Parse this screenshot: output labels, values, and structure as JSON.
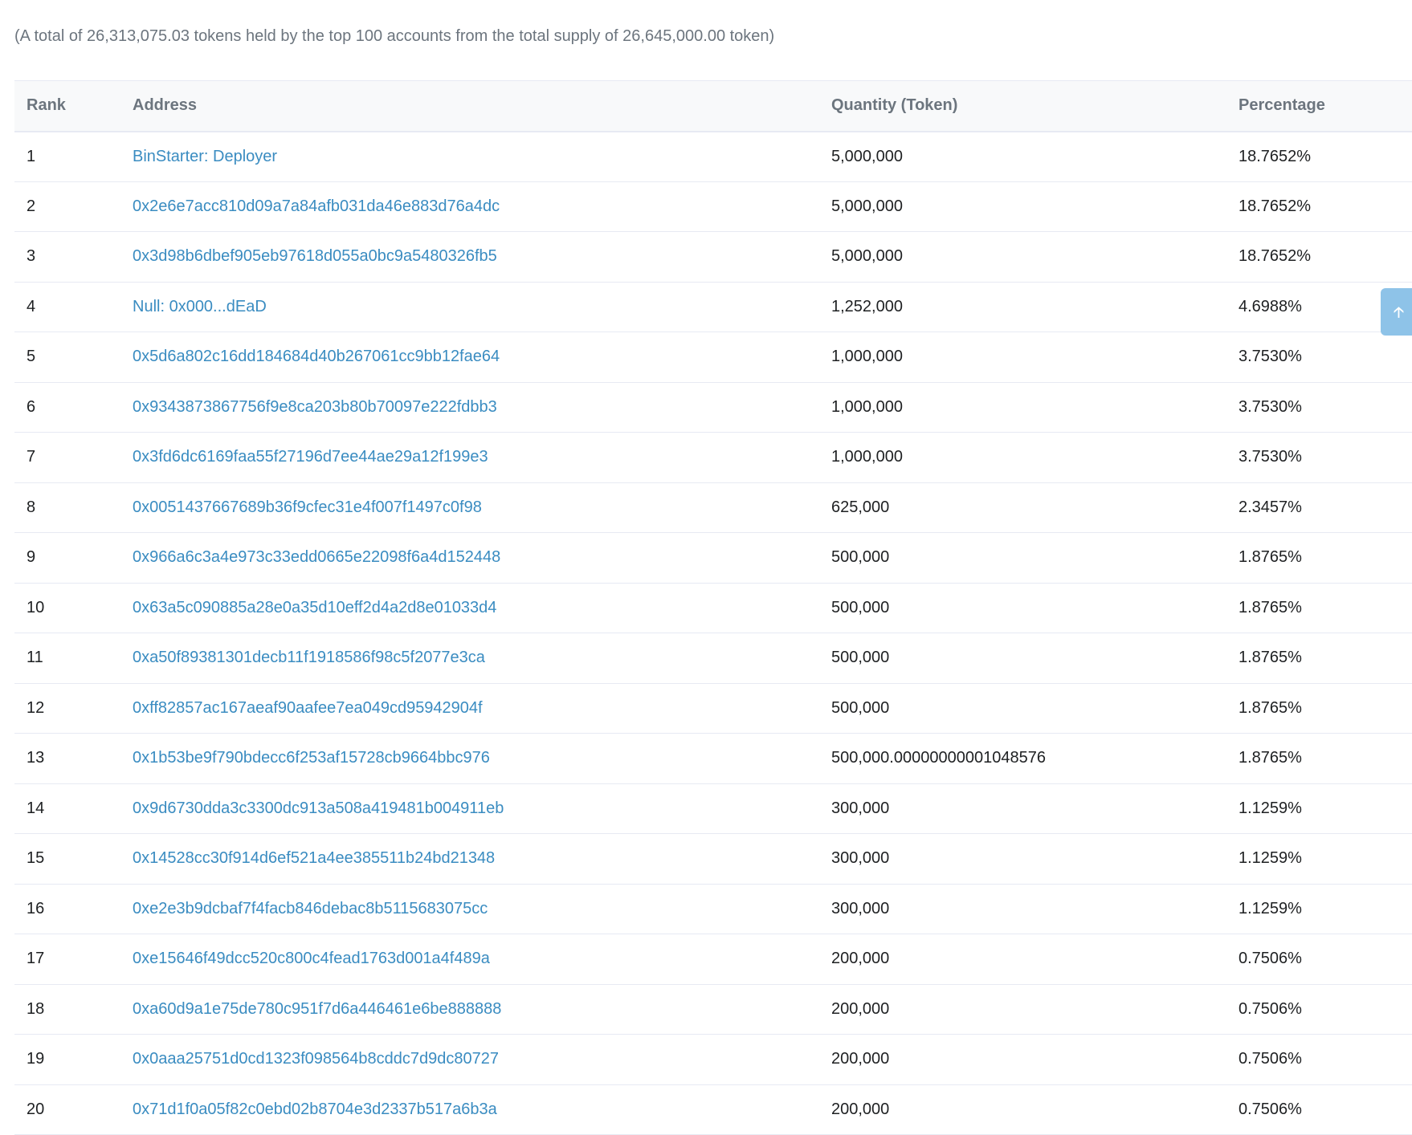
{
  "summary": "(A total of 26,313,075.03 tokens held by the top 100 accounts from the total supply of 26,645,000.00 token)",
  "table": {
    "headers": {
      "rank": "Rank",
      "address": "Address",
      "quantity": "Quantity (Token)",
      "percentage": "Percentage"
    },
    "rows": [
      {
        "rank": "1",
        "address": "BinStarter: Deployer",
        "quantity": "5,000,000",
        "percentage": "18.7652%"
      },
      {
        "rank": "2",
        "address": "0x2e6e7acc810d09a7a84afb031da46e883d76a4dc",
        "quantity": "5,000,000",
        "percentage": "18.7652%"
      },
      {
        "rank": "3",
        "address": "0x3d98b6dbef905eb97618d055a0bc9a5480326fb5",
        "quantity": "5,000,000",
        "percentage": "18.7652%"
      },
      {
        "rank": "4",
        "address": "Null: 0x000...dEaD",
        "quantity": "1,252,000",
        "percentage": "4.6988%"
      },
      {
        "rank": "5",
        "address": "0x5d6a802c16dd184684d40b267061cc9bb12fae64",
        "quantity": "1,000,000",
        "percentage": "3.7530%"
      },
      {
        "rank": "6",
        "address": "0x9343873867756f9e8ca203b80b70097e222fdbb3",
        "quantity": "1,000,000",
        "percentage": "3.7530%"
      },
      {
        "rank": "7",
        "address": "0x3fd6dc6169faa55f27196d7ee44ae29a12f199e3",
        "quantity": "1,000,000",
        "percentage": "3.7530%"
      },
      {
        "rank": "8",
        "address": "0x0051437667689b36f9cfec31e4f007f1497c0f98",
        "quantity": "625,000",
        "percentage": "2.3457%"
      },
      {
        "rank": "9",
        "address": "0x966a6c3a4e973c33edd0665e22098f6a4d152448",
        "quantity": "500,000",
        "percentage": "1.8765%"
      },
      {
        "rank": "10",
        "address": "0x63a5c090885a28e0a35d10eff2d4a2d8e01033d4",
        "quantity": "500,000",
        "percentage": "1.8765%"
      },
      {
        "rank": "11",
        "address": "0xa50f89381301decb11f1918586f98c5f2077e3ca",
        "quantity": "500,000",
        "percentage": "1.8765%"
      },
      {
        "rank": "12",
        "address": "0xff82857ac167aeaf90aafee7ea049cd95942904f",
        "quantity": "500,000",
        "percentage": "1.8765%"
      },
      {
        "rank": "13",
        "address": "0x1b53be9f790bdecc6f253af15728cb9664bbc976",
        "quantity": "500,000.00000000001048576",
        "percentage": "1.8765%"
      },
      {
        "rank": "14",
        "address": "0x9d6730dda3c3300dc913a508a419481b004911eb",
        "quantity": "300,000",
        "percentage": "1.1259%"
      },
      {
        "rank": "15",
        "address": "0x14528cc30f914d6ef521a4ee385511b24bd21348",
        "quantity": "300,000",
        "percentage": "1.1259%"
      },
      {
        "rank": "16",
        "address": "0xe2e3b9dcbaf7f4facb846debac8b5115683075cc",
        "quantity": "300,000",
        "percentage": "1.1259%"
      },
      {
        "rank": "17",
        "address": "0xe15646f49dcc520c800c4fead1763d001a4f489a",
        "quantity": "200,000",
        "percentage": "0.7506%"
      },
      {
        "rank": "18",
        "address": "0xa60d9a1e75de780c951f7d6a446461e6be888888",
        "quantity": "200,000",
        "percentage": "0.7506%"
      },
      {
        "rank": "19",
        "address": "0x0aaa25751d0cd1323f098564b8cddc7d9dc80727",
        "quantity": "200,000",
        "percentage": "0.7506%"
      },
      {
        "rank": "20",
        "address": "0x71d1f0a05f82c0ebd02b8704e3d2337b517a6b3a",
        "quantity": "200,000",
        "percentage": "0.7506%"
      }
    ]
  },
  "scroll_top_button": {
    "icon": "arrow-up-icon"
  },
  "colors": {
    "link": "#3a8cc1",
    "header_bg": "#f8f9fa",
    "muted_text": "#6c757e",
    "border": "#e7eaf3",
    "scroll_button": "#8ec3e8"
  }
}
